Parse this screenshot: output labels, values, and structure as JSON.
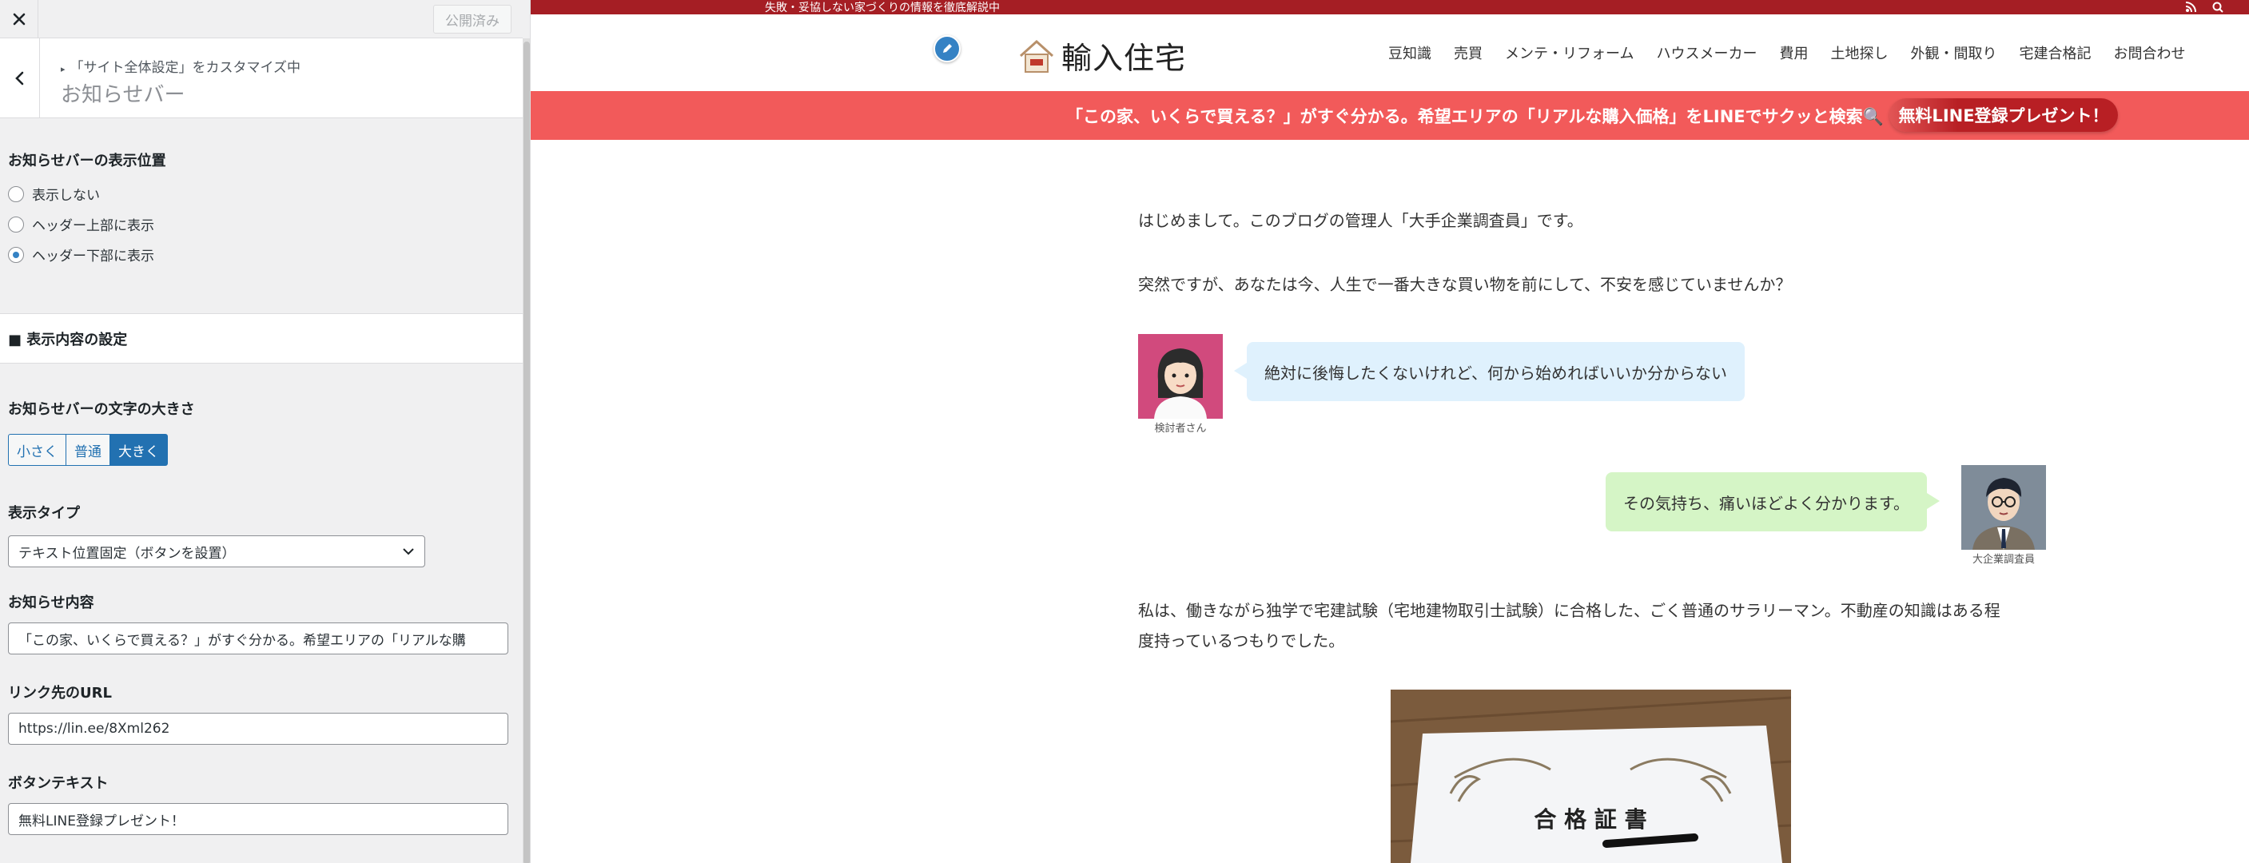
{
  "panel": {
    "publish_label": "公開済み",
    "breadcrumb": "「サイト全体設定」をカスタマイズ中",
    "section_title": "お知らせバー",
    "position_label": "お知らせバーの表示位置",
    "position_options": [
      "表示しない",
      "ヘッダー上部に表示",
      "ヘッダー下部に表示"
    ],
    "position_selected": "ヘッダー下部に表示",
    "content_heading": "■ 表示内容の設定",
    "font_size_label": "お知らせバーの文字の大きさ",
    "font_size_options": [
      "小さく",
      "普通",
      "大きく"
    ],
    "font_size_selected": "大きく",
    "display_type_label": "表示タイプ",
    "display_type_value": "テキスト位置固定（ボタンを設置）",
    "notice_content_label": "お知らせ内容",
    "notice_content_value": "「この家、いくらで買える？」がすぐ分かる。希望エリアの「リアルな購",
    "link_url_label": "リンク先のURL",
    "link_url_value": "https://lin.ee/8Xml262",
    "button_text_label": "ボタンテキスト",
    "button_text_value": "無料LINE登録プレゼント！"
  },
  "site": {
    "topbar_text": "失敗・妥協しない家づくりの情報を徹底解説中",
    "logo_text": "輸入住宅",
    "nav": [
      "豆知識",
      "売買",
      "メンテ・リフォーム",
      "ハウスメーカー",
      "費用",
      "土地探し",
      "外観・間取り",
      "宅建合格記",
      "お問合わせ"
    ],
    "notice_text": "「この家、いくらで買える？」がすぐ分かる。希望エリアの「リアルな購入価格」をLINEでサクッと検索🔍",
    "notice_button": "無料LINE登録プレゼント！",
    "colors": {
      "topbar": "#a51e24",
      "notice": "#f25a5a",
      "notice_button": "#b81f24",
      "accent": "#2271b1"
    }
  },
  "article": {
    "p1": "はじめまして。このブログの管理人「大手企業調査員」です。",
    "p2": "突然ですが、あなたは今、人生で一番大きな買い物を前にして、不安を感じていませんか？",
    "left_bubble": "絶対に後悔したくないけれど、何から始めればいいか分からない",
    "left_caption": "検討者さん",
    "right_bubble": "その気持ち、痛いほどよく分かります。",
    "right_caption": "大企業調査員",
    "p3_line1": "私は、働きながら独学で宅建試験（宅地建物取引士試験）に合格した、ごく普通のサラリーマン。不動産の知識はある程",
    "p3_line2": "度持っているつもりでした。",
    "certificate_title": "合 格 証 書"
  }
}
